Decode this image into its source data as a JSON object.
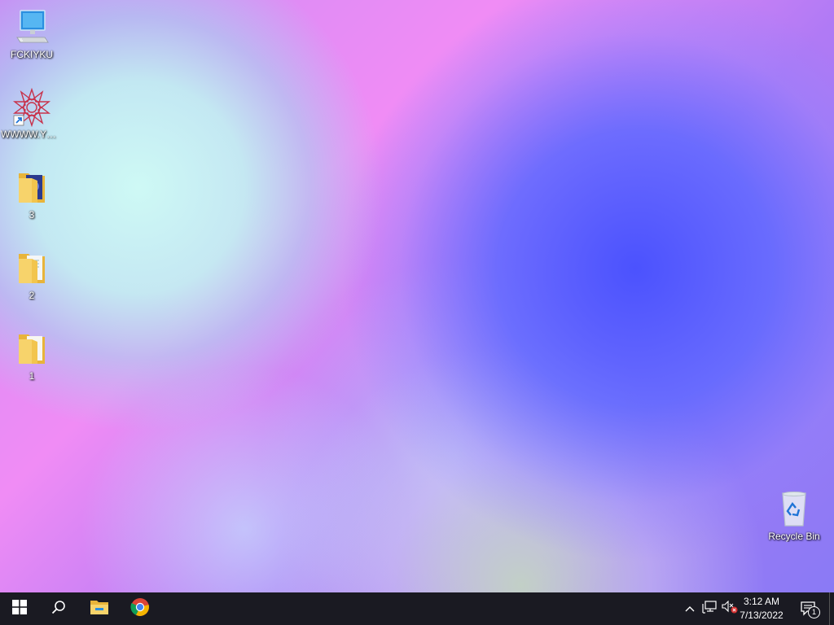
{
  "desktop": {
    "icons": [
      {
        "label": "FCKIYKU",
        "icon": "computer-monitor-icon"
      },
      {
        "label": "WWWW.YOU...",
        "icon": "star-emblem-shortcut-icon"
      },
      {
        "label": "3",
        "icon": "folder-with-image-icon"
      },
      {
        "label": "2",
        "icon": "folder-with-document-icon"
      },
      {
        "label": "1",
        "icon": "empty-folder-icon"
      },
      {
        "label": "Recycle Bin",
        "icon": "recycle-bin-icon"
      }
    ]
  },
  "taskbar": {
    "start": "windows-logo-icon",
    "search": "search-icon",
    "pinned": [
      "file-explorer-icon",
      "chrome-icon"
    ],
    "tray": {
      "chevron": "chevron-up-icon",
      "network": "network-icon",
      "volume": "volume-muted-icon",
      "time": "3:12 AM",
      "date": "7/13/2022",
      "notifications_count": "1"
    }
  },
  "colors": {
    "taskbar_bg": "#1a1a22",
    "folder_yellow": "#f4c542",
    "accent_blue": "#1e73d6"
  }
}
